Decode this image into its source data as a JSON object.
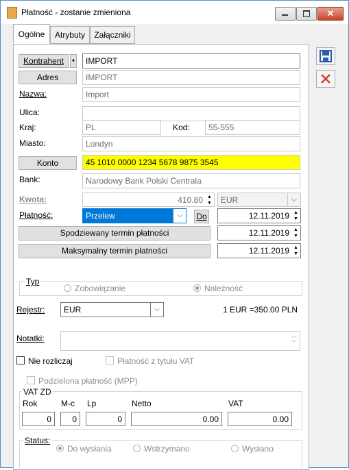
{
  "window": {
    "title": "Płatność - zostanie zmieniona"
  },
  "tabs": [
    "Ogólne",
    "Atrybuty",
    "Załączniki"
  ],
  "form": {
    "kontrahent_btn": "Kontrahent",
    "kontrahent_value": "IMPORT",
    "adres_btn": "Adres",
    "adres_value": "IMPORT",
    "nazwa_label": "Nazwa:",
    "nazwa_value": "Import",
    "ulica_label": "Ulica:",
    "ulica_value": "",
    "kraj_label": "Kraj:",
    "kraj_value": "PL",
    "kod_label": "Kod:",
    "kod_value": "55-555",
    "miasto_label": "Miasto:",
    "miasto_value": "Londyn",
    "konto_btn": "Konto",
    "konto_value": "45 1010 0000 1234 5678 9875 3545",
    "bank_label": "Bank:",
    "bank_value": "Narodowy Bank Polski Centrala",
    "kwota_label": "Kwota:",
    "kwota_value": "410.80",
    "currency_value": "EUR",
    "platnosc_label": "Płatność:",
    "platnosc_value": "Przelew",
    "do_btn": "Do",
    "platnosc_date": "12.11.2019",
    "spodziewany_btn": "Spodziewany termin płatności",
    "spodziewany_date": "12.11.2019",
    "maksymalny_btn": "Maksymalny termin płatności",
    "maksymalny_date": "12.11.2019"
  },
  "typ": {
    "label": "Typ",
    "options": [
      "Zobowiązanie",
      "Należność"
    ],
    "selected": "Należność"
  },
  "rejestr": {
    "label": "Rejestr:",
    "value": "EUR",
    "rate": "1 EUR =350.00 PLN"
  },
  "notatki": {
    "label": "Notatki:",
    "value": ""
  },
  "checks": {
    "nie_rozliczaj": "Nie rozliczaj",
    "platnosc_vat": "Płatność z tytułu VAT",
    "podzielona": "Podzielona płatność (MPP)"
  },
  "vat_zd": {
    "label": "VAT ZD",
    "headers": [
      "Rok",
      "M-c",
      "Lp",
      "Netto",
      "VAT"
    ],
    "values": [
      "0",
      "0",
      "0",
      "0.00",
      "0.00"
    ]
  },
  "status": {
    "label": "Status:",
    "options": [
      "Do wysłania",
      "Wstrzymano",
      "Wysłano"
    ],
    "selected": "Do wysłania"
  },
  "colors": {
    "highlight_yellow": "#ffff00",
    "selection_blue": "#0078d7",
    "save_icon": "#2a5cab",
    "delete_icon": "#d83b2b"
  },
  "icons": {
    "save": "save-icon",
    "delete": "delete-icon"
  }
}
